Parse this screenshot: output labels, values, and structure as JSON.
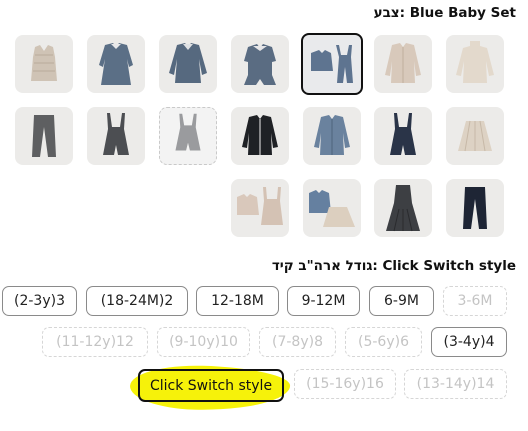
{
  "color_heading": "Blue Baby Set :צבע",
  "swatches": [
    {
      "name": "swatch-beige-knit-vest",
      "label": "beige knit vest"
    },
    {
      "name": "swatch-blue-dress",
      "label": "blue dress"
    },
    {
      "name": "swatch-blue-top",
      "label": "blue top"
    },
    {
      "name": "swatch-blue-romper",
      "label": "blue romper"
    },
    {
      "name": "swatch-blue-baby-set",
      "label": "Blue Baby Set",
      "selected": true
    },
    {
      "name": "swatch-beige-cardigan",
      "label": "beige cardigan"
    },
    {
      "name": "swatch-cream-turtleneck",
      "label": "cream turtleneck"
    },
    {
      "name": "swatch-grey-pants",
      "label": "grey pants"
    },
    {
      "name": "swatch-grey-overall-shorts",
      "label": "grey overall shorts"
    },
    {
      "name": "swatch-grey-romper-shorts",
      "label": "grey romper shorts",
      "unavailable": true
    },
    {
      "name": "swatch-navy-cardigan",
      "label": "navy cardigan"
    },
    {
      "name": "swatch-blue-jacket",
      "label": "blue jacket"
    },
    {
      "name": "swatch-navy-overall-shorts",
      "label": "navy overall shorts"
    },
    {
      "name": "swatch-pleated-skirt",
      "label": "pleated skirt"
    },
    {
      "name": "swatch-beige-skirt-set",
      "label": "beige skirt set"
    },
    {
      "name": "swatch-blue-skirt-set",
      "label": "blue skirt set"
    },
    {
      "name": "swatch-grey-pinafore-dress",
      "label": "grey pinafore dress"
    },
    {
      "name": "swatch-navy-pants",
      "label": "navy pants"
    }
  ],
  "size_heading": "Click Switch style :גודל ארה\"ב קיד",
  "sizes": [
    {
      "label": "(2-3y)3",
      "available": true
    },
    {
      "label": "(18-24M)2",
      "available": true
    },
    {
      "label": "12-18M",
      "available": true
    },
    {
      "label": "9-12M",
      "available": true
    },
    {
      "label": "6-9M",
      "available": true
    },
    {
      "label": "3-6M",
      "available": false
    },
    {
      "label": "(11-12y)12",
      "available": false
    },
    {
      "label": "(9-10y)10",
      "available": false
    },
    {
      "label": "(7-8y)8",
      "available": false
    },
    {
      "label": "(5-6y)6",
      "available": false
    },
    {
      "label": "(3-4y)4",
      "available": true
    },
    {
      "label": "Click Switch style",
      "available": true,
      "highlighted": true
    },
    {
      "label": "(15-16y)16",
      "available": false
    },
    {
      "label": "(13-14y)14",
      "available": false
    }
  ],
  "colors": {
    "highlight": "#f6f20a",
    "selected_border": "#111111"
  }
}
